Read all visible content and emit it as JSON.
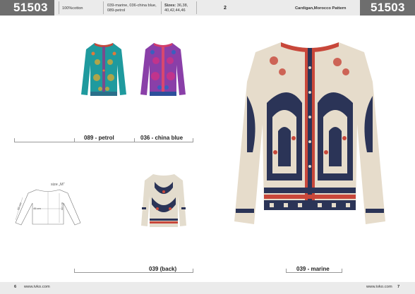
{
  "header": {
    "article_left": "51503",
    "material": "100%cotton",
    "colors_line1": "039-marine, 036-china blue,",
    "colors_line2": "089-petrol",
    "sizes_label": "Sizes:",
    "sizes_line1": "36,38,",
    "sizes_line2": "40,42,44,46",
    "page_number": "2",
    "title": "Cardigan,Morocco Pattern",
    "article_right": "51503"
  },
  "products": [
    {
      "label": "089 - petrol",
      "color": "#1f9a9e"
    },
    {
      "label": "036 - china blue",
      "color": "#8a3fa8"
    },
    {
      "label": "039 (back)",
      "color": "#e3dccd"
    },
    {
      "label": "039 - marine",
      "color": "#e6dccb"
    }
  ],
  "sketch": {
    "size_label": "size „M“",
    "measure_1": "45 cm",
    "measure_2": "60 cm",
    "measure_3": "56 cm"
  },
  "footer": {
    "left_page": "6",
    "left_url": "www.ivko.com",
    "right_url": "www.ivko.com",
    "right_page": "7"
  },
  "colors": {
    "header_bg": "#ebebeb",
    "article_bg": "#6e6e6e",
    "marine_pattern": "#2b3457",
    "accent_red": "#c8473a"
  }
}
